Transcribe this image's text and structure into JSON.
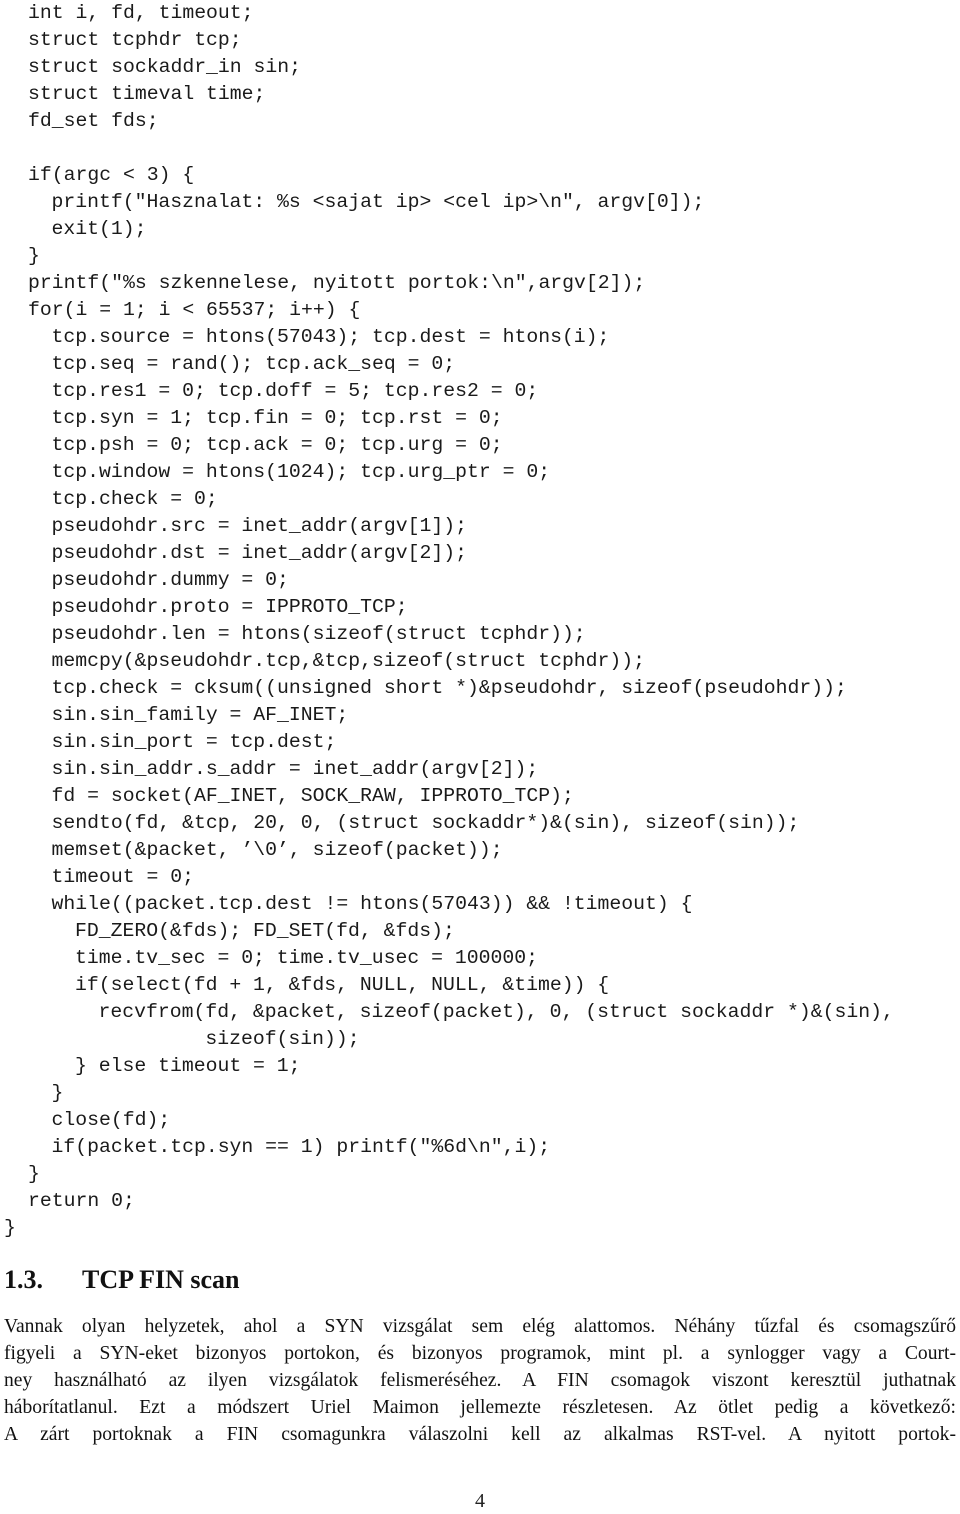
{
  "code": {
    "lines": [
      {
        "indent": 0,
        "text": "int i, fd, timeout;"
      },
      {
        "indent": 0,
        "text": "struct tcphdr tcp;"
      },
      {
        "indent": 0,
        "text": "struct sockaddr_in sin;"
      },
      {
        "indent": 0,
        "text": "struct timeval time;"
      },
      {
        "indent": 0,
        "text": "fd_set fds;"
      },
      {
        "indent": 0,
        "text": ""
      },
      {
        "indent": 0,
        "text": "if(argc < 3) {"
      },
      {
        "indent": 1,
        "text": "printf(\"Hasznalat: %s <sajat ip> <cel ip>\\n\", argv[0]);"
      },
      {
        "indent": 1,
        "text": "exit(1);"
      },
      {
        "indent": 0,
        "text": "}"
      },
      {
        "indent": 0,
        "text": "printf(\"%s szkennelese, nyitott portok:\\n\",argv[2]);"
      },
      {
        "indent": 0,
        "text": "for(i = 1; i < 65537; i++) {"
      },
      {
        "indent": 1,
        "text": "tcp.source = htons(57043); tcp.dest = htons(i);"
      },
      {
        "indent": 1,
        "text": "tcp.seq = rand(); tcp.ack_seq = 0;"
      },
      {
        "indent": 1,
        "text": "tcp.res1 = 0; tcp.doff = 5; tcp.res2 = 0;"
      },
      {
        "indent": 1,
        "text": "tcp.syn = 1; tcp.fin = 0; tcp.rst = 0;"
      },
      {
        "indent": 1,
        "text": "tcp.psh = 0; tcp.ack = 0; tcp.urg = 0;"
      },
      {
        "indent": 1,
        "text": "tcp.window = htons(1024); tcp.urg_ptr = 0;"
      },
      {
        "indent": 1,
        "text": "tcp.check = 0;"
      },
      {
        "indent": 1,
        "text": "pseudohdr.src = inet_addr(argv[1]);"
      },
      {
        "indent": 1,
        "text": "pseudohdr.dst = inet_addr(argv[2]);"
      },
      {
        "indent": 1,
        "text": "pseudohdr.dummy = 0;"
      },
      {
        "indent": 1,
        "text": "pseudohdr.proto = IPPROTO_TCP;"
      },
      {
        "indent": 1,
        "text": "pseudohdr.len = htons(sizeof(struct tcphdr));"
      },
      {
        "indent": 1,
        "text": "memcpy(&pseudohdr.tcp,&tcp,sizeof(struct tcphdr));"
      },
      {
        "indent": 1,
        "text": "tcp.check = cksum((unsigned short *)&pseudohdr, sizeof(pseudohdr));"
      },
      {
        "indent": 1,
        "text": "sin.sin_family = AF_INET;"
      },
      {
        "indent": 1,
        "text": "sin.sin_port = tcp.dest;"
      },
      {
        "indent": 1,
        "text": "sin.sin_addr.s_addr = inet_addr(argv[2]);"
      },
      {
        "indent": 1,
        "text": "fd = socket(AF_INET, SOCK_RAW, IPPROTO_TCP);"
      },
      {
        "indent": 1,
        "text": "sendto(fd, &tcp, 20, 0, (struct sockaddr*)&(sin), sizeof(sin));"
      },
      {
        "indent": 1,
        "text": "memset(&packet, ’\\0’, sizeof(packet));"
      },
      {
        "indent": 1,
        "text": "timeout = 0;"
      },
      {
        "indent": 1,
        "text": "while((packet.tcp.dest != htons(57043)) && !timeout) {"
      },
      {
        "indent": 2,
        "text": "FD_ZERO(&fds); FD_SET(fd, &fds);"
      },
      {
        "indent": 2,
        "text": "time.tv_sec = 0; time.tv_usec = 100000;"
      },
      {
        "indent": 2,
        "text": "if(select(fd + 1, &fds, NULL, NULL, &time)) {"
      },
      {
        "indent": 3,
        "text": "recvfrom(fd, &packet, sizeof(packet), 0, (struct sockaddr *)&(sin),"
      },
      {
        "indent": 3,
        "text": "         sizeof(sin));"
      },
      {
        "indent": 2,
        "text": "} else timeout = 1;"
      },
      {
        "indent": 1,
        "text": "}"
      },
      {
        "indent": 1,
        "text": "close(fd);"
      },
      {
        "indent": 1,
        "text": "if(packet.tcp.syn == 1) printf(\"%6d\\n\",i);"
      },
      {
        "indent": 0,
        "text": "}"
      },
      {
        "indent": 0,
        "text": "return 0;"
      },
      {
        "indent": -1,
        "text": "}"
      }
    ]
  },
  "section": {
    "number": "1.3.",
    "title": "TCP FIN scan"
  },
  "paragraph": {
    "lines": [
      "Vannak olyan helyzetek, ahol a SYN vizsgálat sem elég alattomos. Néhány tűzfal és csomagszűrő",
      "figyeli a SYN-eket bizonyos portokon, és bizonyos programok, mint pl. a synlogger vagy a Court-",
      "ney használható az ilyen vizsgálatok felismeréséhez. A FIN csomagok viszont keresztül juthatnak",
      "háborítatlanul. Ezt a módszert Uriel Maimon jellemezte részletesen. Az ötlet pedig a következő:",
      "A zárt portoknak a FIN csomagunkra válaszolni kell az alkalmas RST-vel. A nyitott portok-"
    ]
  },
  "page_number": "4"
}
